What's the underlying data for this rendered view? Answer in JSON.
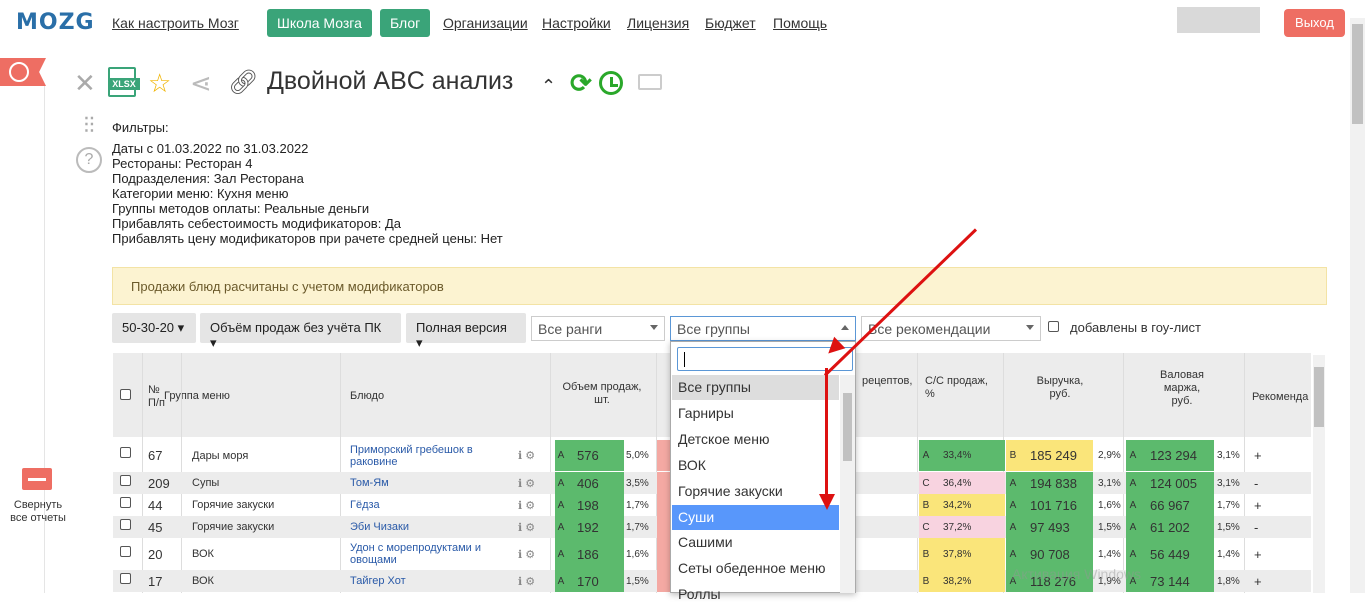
{
  "nav": {
    "logo": "MOZG",
    "links": [
      "Как настроить Мозг",
      "Организации",
      "Настройки",
      "Лицензия",
      "Бюджет",
      "Помощь"
    ],
    "school_button": "Школа Мозга",
    "blog_button": "Блог",
    "logout": "Выход"
  },
  "sidebar": {
    "collapse_label": "Свернуть все отчеты"
  },
  "toolbar": {
    "title": "Двойной ABC анализ",
    "xlsx": "XLSX"
  },
  "filters": {
    "header": "Фильтры:",
    "dates_label": "Даты",
    "dates_value": "с 01.03.2022 по 31.03.2022",
    "restaurants_label": "Рестораны:",
    "restaurants_value": "Ресторан 4",
    "divisions_label": "Подразделения:",
    "divisions_value": "Зал Ресторана",
    "categories_label": "Категории меню:",
    "categories_value": "Кухня меню",
    "payment_label": "Группы методов оплаты:",
    "payment_value": "Реальные деньги",
    "cost_label": "Прибавлять себестоимость модификаторов:",
    "cost_value": "Да",
    "price_label": "Прибавлять цену модификаторов при рачете средней цены:",
    "price_value": "Нет"
  },
  "notice": "Продажи блюд расчитаны с учетом модификаторов",
  "controls": {
    "ratio": "50-30-20",
    "volume": "Объём продаж без учёта ПК",
    "version": "Полная версия",
    "ranks": "Все ранги",
    "groups": "Все группы",
    "recommendations": "Все рекомендации",
    "goulist": "добавлены в гоу-лист"
  },
  "table_headers": {
    "num": "№ П/п",
    "group": "Группа меню",
    "dish": "Блюдо",
    "volume": "Объем продаж, шт.",
    "recipes": "рецептов,",
    "cost": "С/С продаж, %",
    "revenue": "Выручка, руб.",
    "margin": "Валовая маржа, руб.",
    "recommend": "Рекоменда"
  },
  "rows": [
    {
      "num": "67",
      "group": "Дары моря",
      "dish": "Приморский гребешок в раковине",
      "vol_cls": "A",
      "vol": "576",
      "vol_pct": "5,0%",
      "cost_cls": "A",
      "cost": "33,4%",
      "rev_cls": "B",
      "rev": "185 249",
      "rev_pct": "2,9%",
      "mar_cls": "A",
      "mar": "123 294",
      "mar_pct": "3,1%",
      "rec": "+"
    },
    {
      "num": "209",
      "group": "Супы",
      "dish": "Том-Ям",
      "vol_cls": "A",
      "vol": "406",
      "vol_pct": "3,5%",
      "cost_cls": "C",
      "cost": "36,4%",
      "rev_cls": "A",
      "rev": "194 838",
      "rev_pct": "3,1%",
      "mar_cls": "A",
      "mar": "124 005",
      "mar_pct": "3,1%",
      "rec": "-"
    },
    {
      "num": "44",
      "group": "Горячие закуски",
      "dish": "Гёдза",
      "vol_cls": "A",
      "vol": "198",
      "vol_pct": "1,7%",
      "cost_cls": "B",
      "cost": "34,2%",
      "rev_cls": "A",
      "rev": "101 716",
      "rev_pct": "1,6%",
      "mar_cls": "A",
      "mar": "66 967",
      "mar_pct": "1,7%",
      "rec": "+"
    },
    {
      "num": "45",
      "group": "Горячие закуски",
      "dish": "Эби Чизаки",
      "vol_cls": "A",
      "vol": "192",
      "vol_pct": "1,7%",
      "cost_cls": "C",
      "cost": "37,2%",
      "rev_cls": "A",
      "rev": "97 493",
      "rev_pct": "1,5%",
      "mar_cls": "A",
      "mar": "61 202",
      "mar_pct": "1,5%",
      "rec": "-"
    },
    {
      "num": "20",
      "group": "ВОК",
      "dish": "Удон с морепродуктами и овощами",
      "vol_cls": "A",
      "vol": "186",
      "vol_pct": "1,6%",
      "cost_cls": "B",
      "cost": "37,8%",
      "rev_cls": "A",
      "rev": "90 708",
      "rev_pct": "1,4%",
      "mar_cls": "A",
      "mar": "56 449",
      "mar_pct": "1,4%",
      "rec": "+"
    },
    {
      "num": "17",
      "group": "ВОК",
      "dish": "Тайгер Хот",
      "vol_cls": "A",
      "vol": "170",
      "vol_pct": "1,5%",
      "cost_cls": "B",
      "cost": "38,2%",
      "rev_cls": "A",
      "rev": "118 276",
      "rev_pct": "1,9%",
      "mar_cls": "A",
      "mar": "73 144",
      "mar_pct": "1,8%",
      "rec": "+"
    }
  ],
  "dropdown": {
    "options": [
      "Все группы",
      "Гарниры",
      "Детское меню",
      "ВОК",
      "Горячие закуски",
      "Суши",
      "Сашими",
      "Сеты обеденное меню",
      "Роллы"
    ],
    "highlighted": "Суши"
  },
  "watermark": "Активация Windows",
  "colors": {
    "green": "#3aa479",
    "red": "#ee6e63",
    "highlight": "#5897fb",
    "arrow": "#d11111"
  }
}
